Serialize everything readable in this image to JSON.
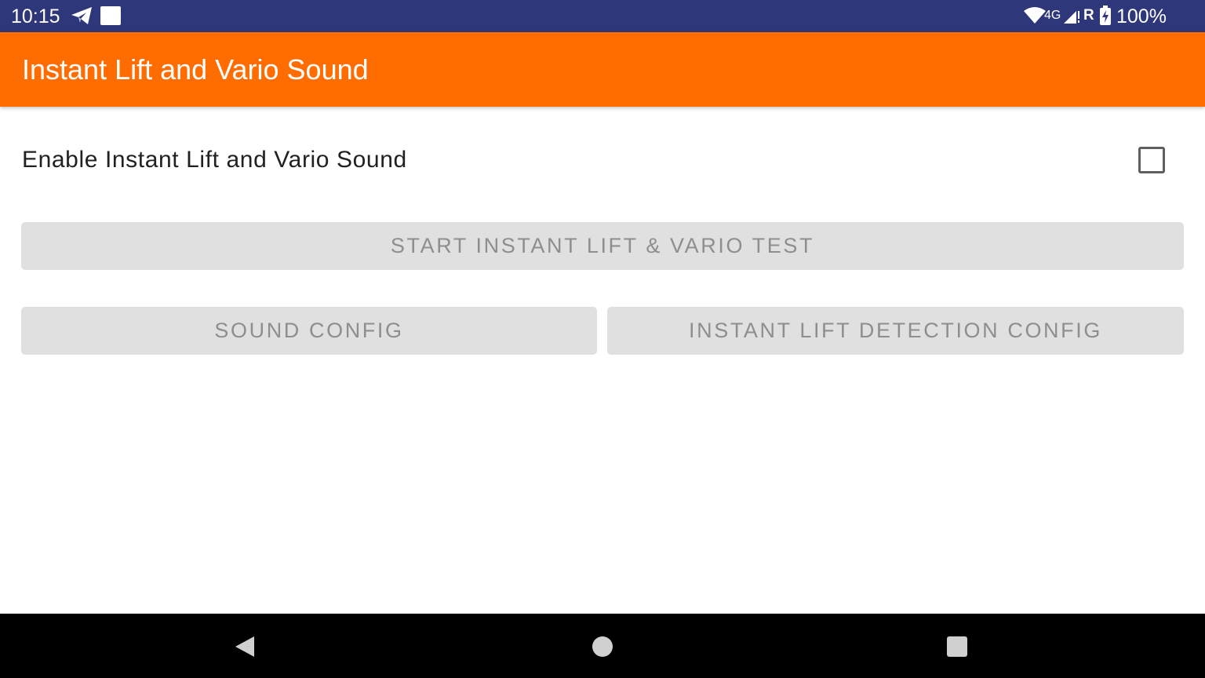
{
  "status_bar": {
    "time": "10:15",
    "network": "4G",
    "roaming": "R",
    "battery": "100%",
    "icons": [
      "telegram-icon",
      "notification-square-icon",
      "wifi-icon",
      "signal-icon",
      "battery-charging-icon"
    ]
  },
  "app_bar": {
    "title": "Instant Lift and Vario Sound",
    "color": "#ff6d00"
  },
  "settings": {
    "enable_label": "Enable Instant Lift and Vario Sound",
    "enable_checked": false
  },
  "buttons": {
    "start_test": "START INSTANT LIFT & VARIO TEST",
    "sound_config": "SOUND CONFIG",
    "detection_config": "INSTANT LIFT DETECTION CONFIG"
  },
  "nav_bar": {
    "icons": [
      "back-icon",
      "home-icon",
      "recents-icon"
    ]
  }
}
